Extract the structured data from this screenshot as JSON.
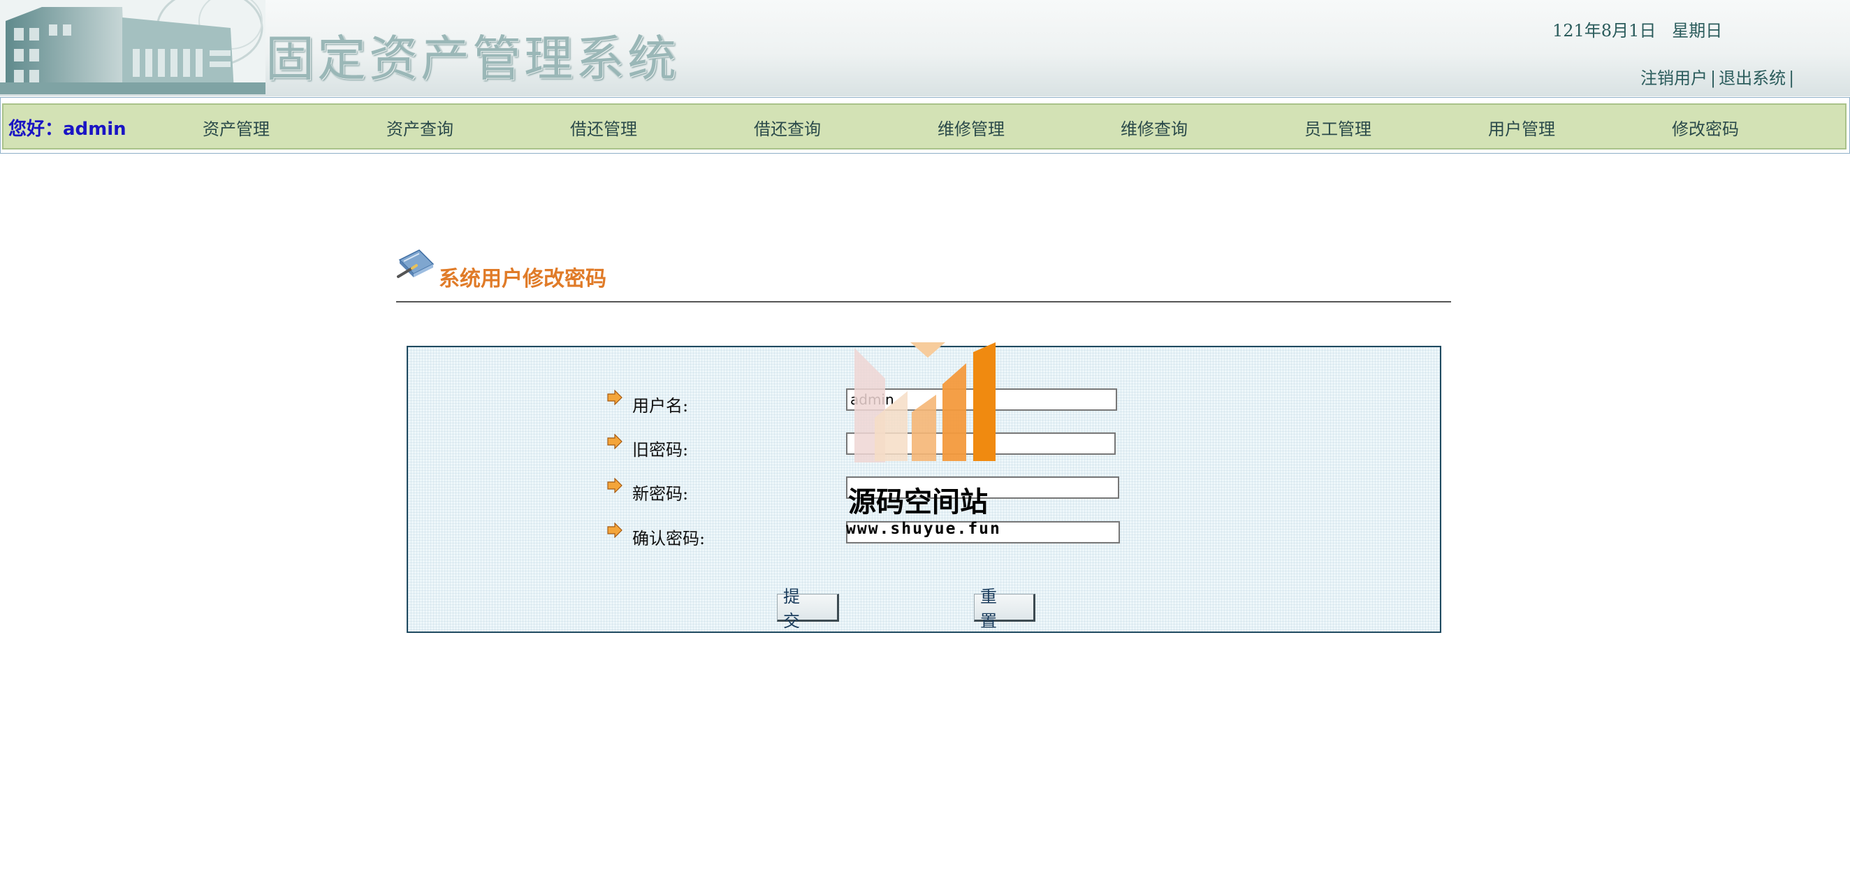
{
  "header": {
    "system_title": "固定资产管理系统",
    "date": "121年8月1日",
    "weekday": "星期日",
    "logout_user_label": "注销用户",
    "exit_system_label": "退出系统",
    "separator": "|"
  },
  "nav": {
    "greeting_prefix": "您好：",
    "username": "admin",
    "items": [
      {
        "label": "资产管理"
      },
      {
        "label": "资产查询"
      },
      {
        "label": "借还管理"
      },
      {
        "label": "借还查询"
      },
      {
        "label": "维修管理"
      },
      {
        "label": "维修查询"
      },
      {
        "label": "员工管理"
      },
      {
        "label": "用户管理"
      },
      {
        "label": "修改密码"
      }
    ]
  },
  "page": {
    "title": "系统用户修改密码"
  },
  "form": {
    "username_label": "用户名:",
    "username_value": "admin",
    "old_password_label": "旧密码:",
    "new_password_label": "新密码:",
    "confirm_password_label": "确认密码:",
    "submit_label": "提 交",
    "reset_label": "重 置"
  },
  "watermark": {
    "name": "源码空间站",
    "url": "www.shuyue.fun"
  },
  "colors": {
    "nav_background": "#d3e2b5",
    "greeting": "#1a14c4",
    "title_orange": "#e07b28",
    "link_teal": "#2b5c5c",
    "panel_border": "#1f4a60"
  }
}
